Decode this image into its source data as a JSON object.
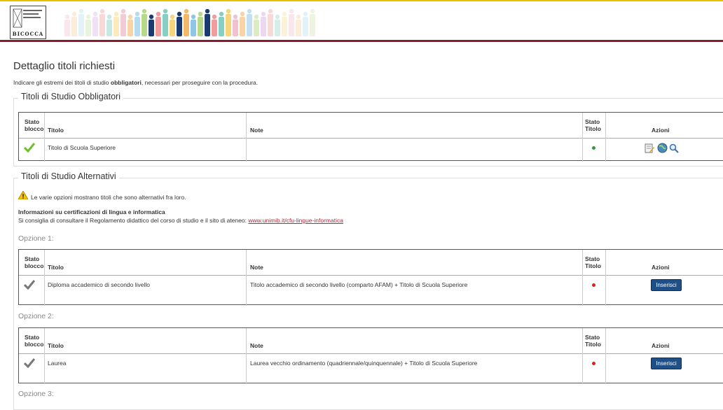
{
  "header": {
    "logo_text": "BICOCCA",
    "logo_top_text": "UNIVERSITÀ DEGLI STUDI DI MILANO"
  },
  "page": {
    "title": "Dettaglio titoli richiesti",
    "intro_pre": "Indicare gli estremi dei titoli di studio ",
    "intro_bold": "obbligatori",
    "intro_post": ", necessari per proseguire con la procedura."
  },
  "columns": {
    "stato_blocco_1": "Stato",
    "stato_blocco_2": "blocco",
    "titolo": "Titolo",
    "note": "Note",
    "stato_titolo_1": "Stato",
    "stato_titolo_2": "Titolo",
    "azioni": "Azioni"
  },
  "obbligatori": {
    "legend": "Titoli di Studio Obbligatori",
    "row": {
      "titolo": "Titolo di Scuola Superiore",
      "note": "",
      "status_color": "#2e9e2e"
    }
  },
  "alternativi": {
    "legend": "Titoli di Studio Alternativi",
    "warning": "Le varie opzioni mostrano titoli che sono alternativi fra loro.",
    "info_title": "Informazioni su certificazioni di lingua e informatica",
    "info_text": "Si consiglia di consultare il Regolamento didattico del corso di studio e il sito di ateneo: ",
    "info_link": "www.unimib.it/cfu-lingue-informatica",
    "options": [
      {
        "label": "Opzione 1:",
        "titolo": "Diploma accademico di secondo livello",
        "note": "Titolo accademico di secondo livello (comparto AFAM) + Titolo di Scuola Superiore",
        "button": "Inserisci",
        "status_color": "#e02020"
      },
      {
        "label": "Opzione 2:",
        "titolo": "Laurea",
        "note": "Laurea vecchio ordinamento (quadriennale/quinquennale) + Titolo di Scuola Superiore",
        "button": "Inserisci",
        "status_color": "#e02020"
      },
      {
        "label": "Opzione 3:"
      }
    ]
  },
  "colors": {
    "accent": "#8a1b2c",
    "button": "#1f4f87",
    "link": "#b0283a"
  }
}
